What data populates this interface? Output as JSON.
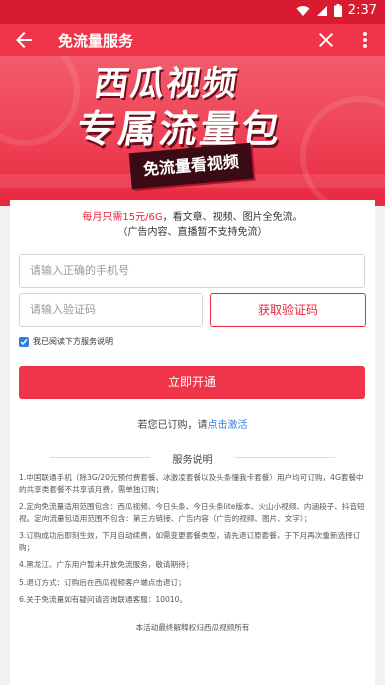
{
  "status_bar": {
    "time": "2:37",
    "icons": [
      "wifi-icon",
      "signal-icon",
      "battery-icon"
    ]
  },
  "app_bar": {
    "title": "免流量服务",
    "icons": [
      "back-arrow-icon",
      "close-icon",
      "more-vert-icon"
    ]
  },
  "banner": {
    "headline_1": "西瓜视频",
    "headline_2": "专属流量包",
    "badge": "免流量看视频"
  },
  "promo": {
    "highlight": "每月只需15元/6G",
    "text": "，看文章、视频、图片全免流。",
    "note": "（广告内容、直播暂不支持免流）"
  },
  "form": {
    "phone_placeholder": "请输入正确的手机号",
    "code_placeholder": "请输入验证码",
    "get_code_label": "获取验证码",
    "agree_label": "我已阅读下方服务说明",
    "agree_checked": true,
    "submit_label": "立即开通"
  },
  "activate": {
    "text": "若您已订购，请",
    "link": "点击激活"
  },
  "service": {
    "title": "服务说明",
    "rules": [
      "1.中国联通手机（除3G/20元预付费套餐、冰激凌套餐以及头条懂我卡套餐）用户均可订购，4G套餐中的共享类套餐不共享该月费，需单独订购；",
      "2.定向免流量适用范围包含：西瓜视频、今日头条、今日头条lite版本、火山小视频、内涵段子、抖音短视。定向流量包适用范围不包含：第三方链接、广告内容（广告的视频、图片、文字）；",
      "3.订购成功后即刻生效，下月自动续费，如需变更套餐类型，请先退订原套餐，于下月再次重新选择订购；",
      "4.黑龙江、广东用户暂未开放免流服务，敬请期待；",
      "5.退订方式：订购后在西瓜视频客户端点击退订；",
      "6.关于免流量如有疑问请咨询联通客服：10010。"
    ],
    "footer": "本活动最终解释权归西瓜视频所有"
  },
  "colors": {
    "brand_red": "#f0354a",
    "status_red": "#d81b30",
    "link_blue": "#2f7fe0"
  }
}
